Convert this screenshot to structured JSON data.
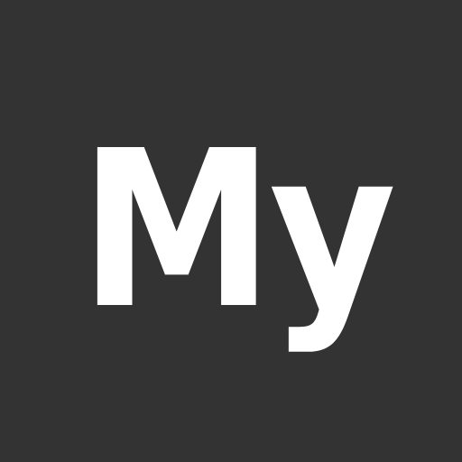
{
  "logo": {
    "text": "My",
    "background_color": "#333333",
    "text_color": "#ffffff"
  }
}
